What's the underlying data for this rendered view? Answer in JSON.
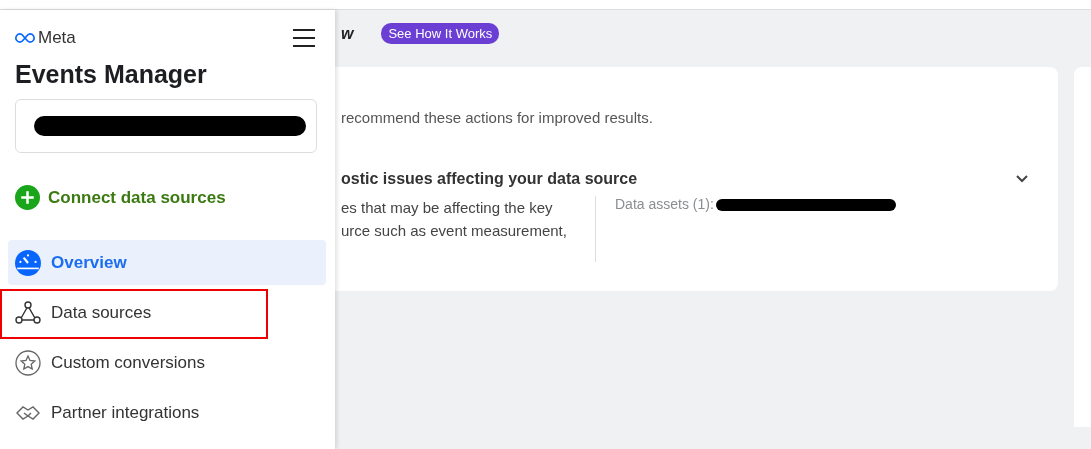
{
  "sidebar": {
    "brand": "Meta",
    "title": "Events Manager",
    "account_redacted": true,
    "connect_button": "Connect data sources",
    "items": [
      {
        "label": "Overview",
        "selected": true,
        "highlighted": false
      },
      {
        "label": "Data sources",
        "selected": false,
        "highlighted": true
      },
      {
        "label": "Custom conversions",
        "selected": false,
        "highlighted": false
      },
      {
        "label": "Partner integrations",
        "selected": false,
        "highlighted": false
      }
    ]
  },
  "header": {
    "title_fragment": "w",
    "badge": "See How It Works"
  },
  "card": {
    "intro": "recommend these actions for improved results.",
    "issue_title": "ostic issues affecting your data source",
    "issue_lines": [
      "es that may be affecting the key",
      "urce such as event measurement,"
    ],
    "assets_label": "Data assets (1):",
    "assets_redacted": true,
    "expanded": false
  }
}
